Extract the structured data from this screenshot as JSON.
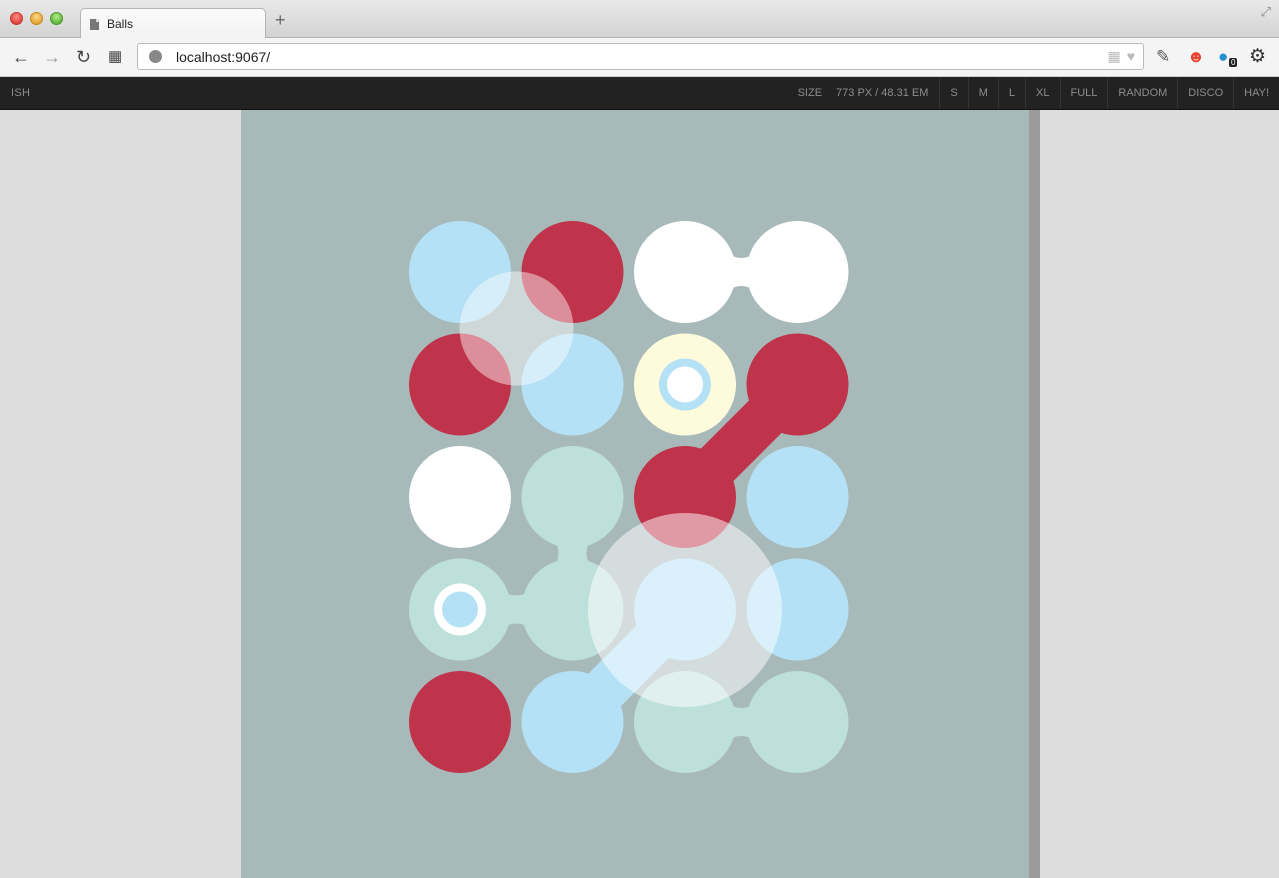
{
  "browser": {
    "tab_title": "Balls",
    "url": "localhost:9067/",
    "new_tab_icon": "plus-icon",
    "extension_badge": "0"
  },
  "ishbar": {
    "logo": "ISH",
    "size_label": "SIZE",
    "size_value": "773 PX / 48.31 EM",
    "buttons": [
      "S",
      "M",
      "L",
      "XL",
      "FULL",
      "RANDOM",
      "DISCO",
      "HAY!"
    ]
  },
  "colors": {
    "blue": "#b5e1f6",
    "red": "#bf344a",
    "white": "#ffffff",
    "teal": "#bee0da",
    "cream": "#fefbdc",
    "background": "#a8b9ba"
  },
  "balls": {
    "rows": [
      [
        "blue",
        "red",
        "white",
        "white"
      ],
      [
        "red",
        "blue",
        "cream",
        "red"
      ],
      [
        "white",
        "teal",
        "red",
        "blue"
      ],
      [
        "teal",
        "teal",
        "blue",
        "blue"
      ],
      [
        "red",
        "blue",
        "teal",
        "teal"
      ]
    ]
  }
}
